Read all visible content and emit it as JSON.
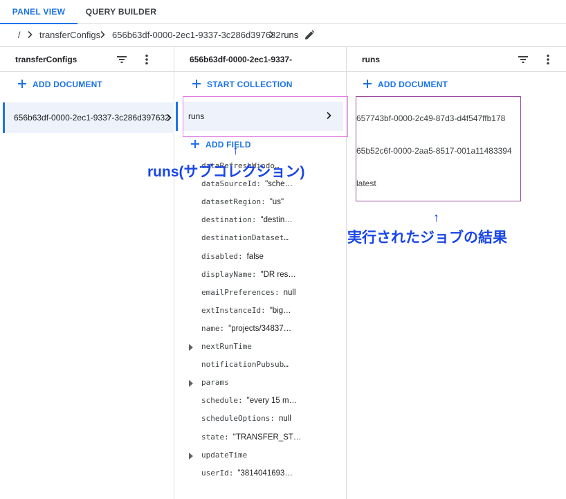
{
  "tabs": [
    {
      "label": "PANEL VIEW",
      "active": true
    },
    {
      "label": "QUERY BUILDER",
      "active": false
    }
  ],
  "breadcrumb": {
    "root": "/",
    "items": [
      "transferConfigs",
      "656b63df-0000-2ec1-9337-3c286d397632",
      "runs"
    ]
  },
  "panel1": {
    "title": "transferConfigs",
    "add_label": "ADD DOCUMENT",
    "documents": [
      "656b63df-0000-2ec1-9337-3c286d397632"
    ]
  },
  "panel2": {
    "title": "656b63df-0000-2ec1-9337-",
    "start_collection_label": "START COLLECTION",
    "collections": [
      "runs"
    ],
    "add_field_label": "ADD FIELD",
    "fields": [
      {
        "key": "dataRefreshWindo…",
        "value": "",
        "expandable": false
      },
      {
        "key": "dataSourceId:",
        "value": "\"sche…",
        "expandable": false
      },
      {
        "key": "datasetRegion:",
        "value": "\"us\"",
        "expandable": false
      },
      {
        "key": "destination:",
        "value": "\"destin…",
        "expandable": false
      },
      {
        "key": "destinationDataset…",
        "value": "",
        "expandable": false
      },
      {
        "key": "disabled:",
        "value": "false",
        "expandable": false
      },
      {
        "key": "displayName:",
        "value": "\"DR res…",
        "expandable": false
      },
      {
        "key": "emailPreferences:",
        "value": "null",
        "expandable": false
      },
      {
        "key": "extInstanceId:",
        "value": "\"big…",
        "expandable": false
      },
      {
        "key": "name:",
        "value": "\"projects/34837…",
        "expandable": false
      },
      {
        "key": "nextRunTime",
        "value": "",
        "expandable": true
      },
      {
        "key": "notificationPubsub…",
        "value": "",
        "expandable": false
      },
      {
        "key": "params",
        "value": "",
        "expandable": true
      },
      {
        "key": "schedule:",
        "value": "\"every 15 m…",
        "expandable": false
      },
      {
        "key": "scheduleOptions:",
        "value": "null",
        "expandable": false
      },
      {
        "key": "state:",
        "value": "\"TRANSFER_ST…",
        "expandable": false
      },
      {
        "key": "updateTime",
        "value": "",
        "expandable": true
      },
      {
        "key": "userId:",
        "value": "\"3814041693…",
        "expandable": false
      }
    ]
  },
  "panel3": {
    "title": "runs",
    "add_label": "ADD DOCUMENT",
    "documents": [
      "657743bf-0000-2c49-87d3-d4f547ffb178",
      "65b52c6f-0000-2aa5-8517-001a11483394",
      "latest"
    ]
  },
  "annotations": {
    "subcollection": "runs(サブコレクション)",
    "results": "実行されたジョブの結果",
    "arrow": "↑"
  },
  "colors": {
    "accent": "#1a73e8",
    "annotation_text": "#1a46e6",
    "box_pink": "#e37ae3",
    "box_purple": "#9c4a9c"
  },
  "icons": [
    "chevron-right-icon",
    "edit-pencil-icon",
    "filter-icon",
    "more-vert-icon",
    "plus-icon",
    "expand-arrow-icon"
  ]
}
